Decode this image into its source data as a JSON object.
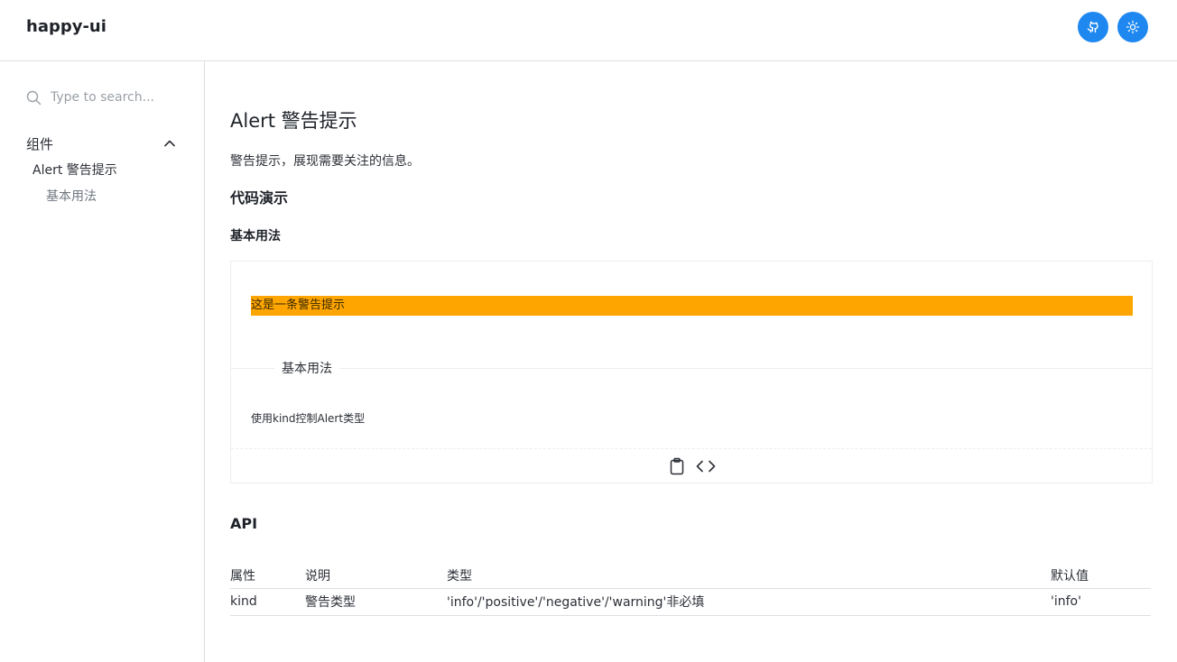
{
  "header": {
    "brand": "happy-ui"
  },
  "sidebar": {
    "search_placeholder": "Type to search...",
    "group_label": "组件",
    "items": [
      {
        "label": "Alert 警告提示",
        "children": [
          {
            "label": "基本用法"
          }
        ]
      }
    ]
  },
  "main": {
    "title": "Alert 警告提示",
    "description": "警告提示，展现需要关注的信息。",
    "demo_heading": "代码演示",
    "basic_heading": "基本用法",
    "demo": {
      "alert_text": "这是一条警告提示",
      "alert_color": "#ffa500",
      "meta_title": "基本用法",
      "meta_description": "使用kind控制Alert类型"
    },
    "api_heading": "API",
    "api_table": {
      "headers": [
        "属性",
        "说明",
        "类型",
        "默认值"
      ],
      "rows": [
        [
          "kind",
          "警告类型",
          "'info'/'positive'/'negative'/'warning'非必填",
          "'info'"
        ]
      ]
    }
  },
  "colors": {
    "accent": "#1e88f0"
  },
  "icons": [
    "github-icon",
    "sun-icon",
    "search-icon",
    "chevron-up-icon",
    "clipboard-icon",
    "code-icon"
  ]
}
